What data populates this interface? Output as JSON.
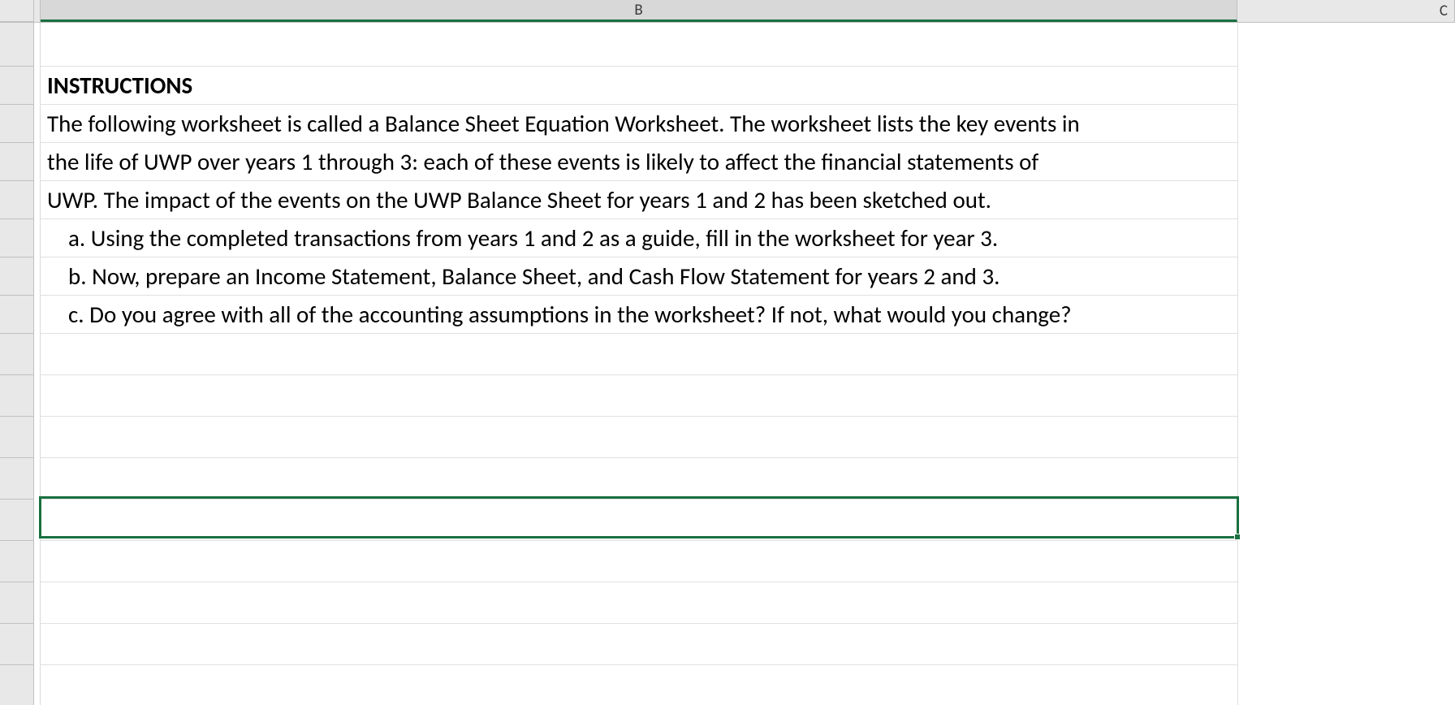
{
  "columns": {
    "b": "B",
    "c": "C"
  },
  "rows": {
    "r2": "INSTRUCTIONS",
    "r3": "The following worksheet is called a Balance Sheet Equation Worksheet. The worksheet lists the key events in",
    "r4": "the life of UWP over years 1 through 3: each of these events is likely to affect the financial statements of",
    "r5": "UWP. The impact of the events on the UWP Balance Sheet for years 1 and 2 has been sketched out.",
    "r6": "a. Using the completed transactions from years 1 and 2 as a guide, fill in the worksheet for year 3.",
    "r7": "b. Now, prepare an Income Statement, Balance Sheet, and Cash Flow Statement for years 2 and 3.",
    "r8": "c. Do you agree with all of the accounting assumptions in the worksheet? If not, what would you change?"
  }
}
